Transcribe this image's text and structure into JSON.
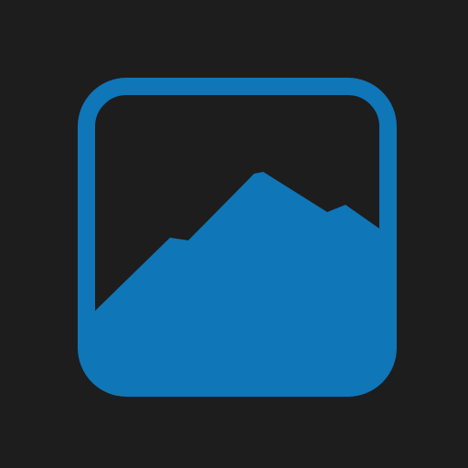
{
  "background_color": "#1d1d1d",
  "accent_color": "#0f76b8",
  "icon": {
    "name": "image-placeholder-icon",
    "depicts": "mountain-landscape"
  }
}
